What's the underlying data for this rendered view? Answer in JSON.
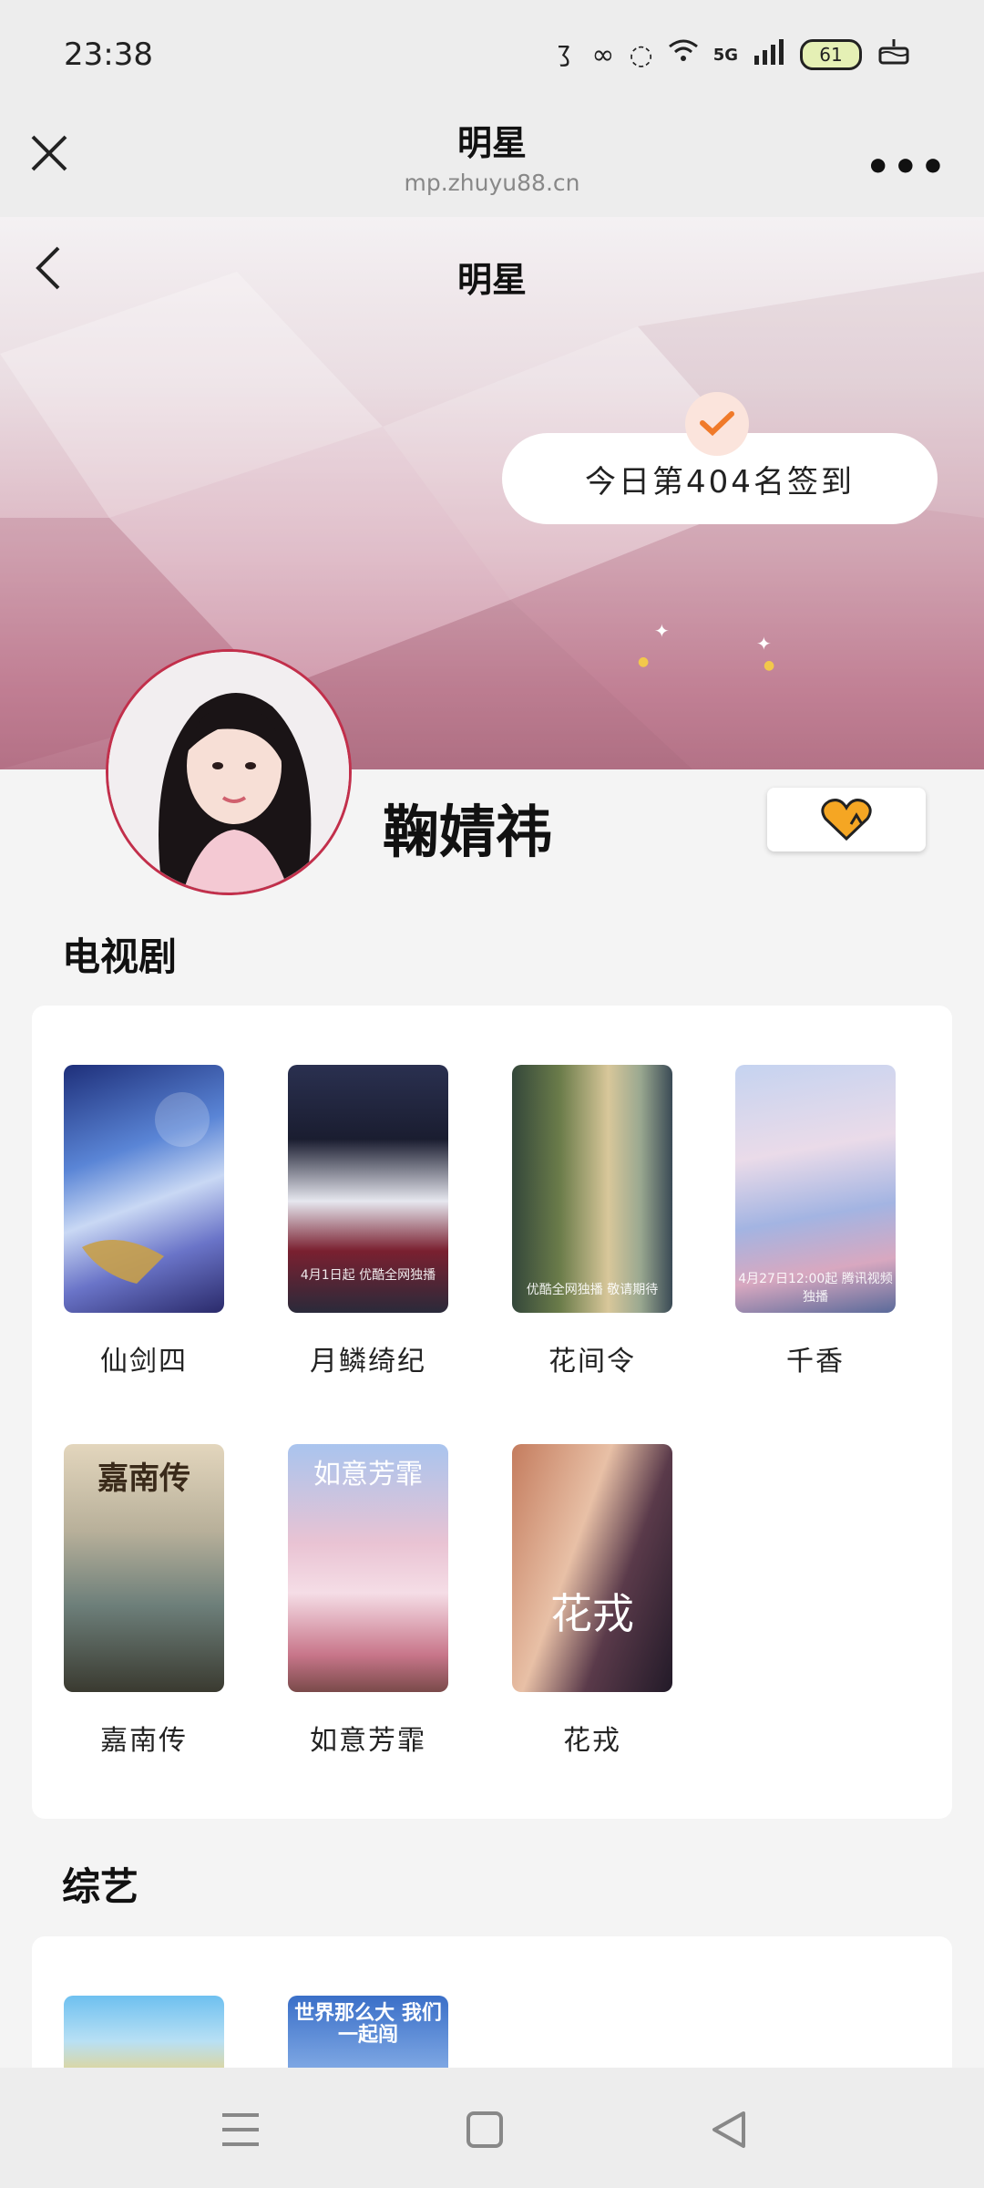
{
  "status_bar": {
    "time": "23:38",
    "network": "5G",
    "battery": "61",
    "icons": [
      "notification-icon",
      "infinity-icon",
      "cat-icon",
      "wifi-icon",
      "signal-icon",
      "battery-icon",
      "cake-icon"
    ]
  },
  "nav": {
    "title": "明星",
    "url": "mp.zhuyu88.cn",
    "more": "•••"
  },
  "hero": {
    "title": "明星",
    "signin_text": "今日第404名签到"
  },
  "profile": {
    "name": "鞠婧祎"
  },
  "tv_section": {
    "title": "电视剧",
    "items": [
      {
        "label": "仙剑四",
        "poster_colors": [
          "#2c4fa8",
          "#9fb6e8",
          "#3a2a7a"
        ]
      },
      {
        "label": "月鳞绮纪",
        "poster_colors": [
          "#1d2238",
          "#c7c9d8",
          "#7a1f2a"
        ]
      },
      {
        "label": "花间令",
        "poster_colors": [
          "#3f5a3a",
          "#cdb98a",
          "#2b3a4a"
        ]
      },
      {
        "label": "千香",
        "poster_colors": [
          "#8e9fd6",
          "#e9d7e6",
          "#5a6ea8"
        ]
      },
      {
        "label": "嘉南传",
        "poster_colors": [
          "#d9cbb0",
          "#6d7f7a",
          "#3a3328"
        ]
      },
      {
        "label": "如意芳霏",
        "poster_colors": [
          "#9bb7e6",
          "#f2c7d6",
          "#c5506a"
        ]
      },
      {
        "label": "花戎",
        "poster_colors": [
          "#c88a6c",
          "#e9c6ae",
          "#2a2030"
        ]
      }
    ],
    "poster_captions": {
      "yuelin": "4月1日起 优酷全网独播",
      "huajianling": "优酷全网独播 敬请期待",
      "qianxiang": "4月27日12:00起 腾讯视频独播",
      "jianan": "嘉南传",
      "ruyi": "如意芳霏",
      "huarong": "花戎"
    }
  },
  "variety_section": {
    "title": "综艺",
    "items": [
      {
        "caption": "",
        "poster_colors": [
          "#5cb0e8",
          "#f0d070"
        ]
      },
      {
        "caption": "世界那么大 我们一起闯",
        "poster_colors": [
          "#3a6fc8",
          "#8fb5ea"
        ]
      }
    ]
  },
  "colors": {
    "accent": "#f5a623",
    "avatar_border": "#c22f4b",
    "check": "#f07a2a"
  }
}
